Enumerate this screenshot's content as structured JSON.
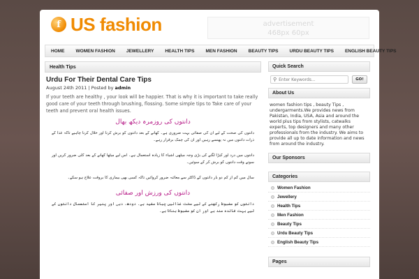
{
  "site": {
    "logo_letter": "f",
    "logo_text": "US fashion",
    "ad_line1": "advertisement",
    "ad_line2": "468px 60px"
  },
  "nav": {
    "items": [
      "HOME",
      "WOMEN FASHION",
      "JEWELLERY",
      "HEALTH TIPS",
      "MEN FASHION",
      "BEAUTY TIPS",
      "URDU BEAUTY TIPS",
      "ENGLISH BEAUTY TIPS"
    ]
  },
  "main": {
    "section_title": "Health Tips",
    "post_title": "Urdu For Their Dental Care Tips",
    "post_date": "August 24th 2011 | Posted by ",
    "post_author": "admin",
    "post_excerpt": "If your teeth are healthy , your look will be happier. That is why it is important to take really good care of your teeth through brushing, flossing. Some simple tips to Take care of your teeth and prevent oral health issues.",
    "urdu_heading_1": "دانتوں کی روزمرہ دیکھ بھال",
    "urdu_para_1": "دانتوں کی صحت کے لیے ان کی صفائی بہت ضروری ہے۔ کھانے کے بعد دانتوں کو برش کرنا اور خلال کرنا چاہیے تاکہ غذا کے ذرات دانتوں میں نہ پھنسے رہیں اور ان کی چمک برقرار رہے۔",
    "urdu_para_2": "دانتوں میں درد اور کیڑا لگنے کی بڑی وجہ میٹھی اشیاء کا زیادہ استعمال ہے۔ اس لیے میٹھا کھانے کے بعد کلی ضرور کریں اور سوتے وقت دانتوں کو برش کر کے سوئیں۔",
    "urdu_para_3": "سال میں کم از کم دو بار دانتوں کے ڈاکٹر سے معائنہ ضرور کروائیں تاکہ کسی بھی بیماری کا بروقت علاج ہو سکے۔",
    "urdu_heading_2": "دانتوں کی ورزش اور صفائی",
    "urdu_para_4": "دانتوں کو مضبوط رکھنے کے لیے سخت غذائیں چبانا مفید ہے۔ دودھ، دہی اور پنیر کا استعمال دانتوں کے لیے بہت فائدہ مند ہے اور ان کو مضبوط بناتا ہے۔"
  },
  "sidebar": {
    "quick_search_title": "Quick Search",
    "search_placeholder": "Enter Keywords...",
    "go_label": "GO!",
    "about_title": "About Us",
    "about_text": "women fashion tips , beauty Tips , undergarments.We provides news from Pakistan, India, USA, Asia and around the world plus tips from stylists, catwalks experts, top designers and many other professionals from the industry. We aims to provide all up to date information and news from around the industry.",
    "sponsors_title": "Our Sponsors",
    "categories_title": "Categories",
    "categories": [
      "Women Fashion",
      "Jewellery",
      "Health Tips",
      "Men Fashion",
      "Beauty Tips",
      "Urdu Beauty Tips",
      "English Beauty Tips"
    ],
    "pages_title": "Pages"
  }
}
